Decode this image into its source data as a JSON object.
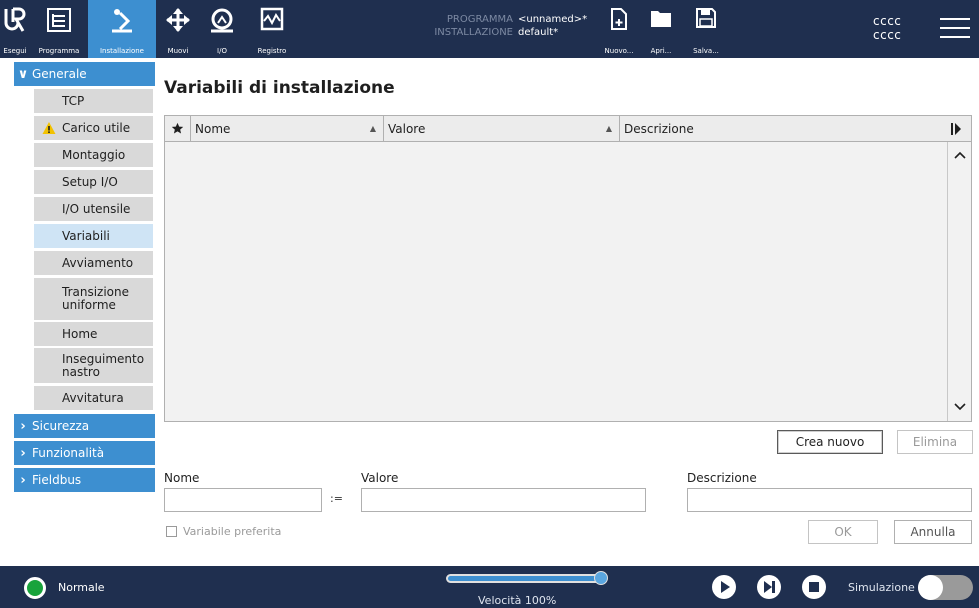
{
  "header": {
    "nav": [
      {
        "label": "Esegui",
        "icon": "ur-logo-icon"
      },
      {
        "label": "Programma",
        "icon": "program-tree-icon"
      },
      {
        "label": "Installazione",
        "icon": "installation-robot-icon",
        "active": true
      },
      {
        "label": "Muovi",
        "icon": "move-arrows-icon"
      },
      {
        "label": "I/O",
        "icon": "io-icon"
      },
      {
        "label": "Registro",
        "icon": "log-chart-icon"
      }
    ],
    "program_key": "PROGRAMMA",
    "program_value": "<unnamed>*",
    "installation_key": "INSTALLAZIONE",
    "installation_value": "default*",
    "file_actions": [
      {
        "label": "Nuovo...",
        "icon": "new-file-icon"
      },
      {
        "label": "Apri...",
        "icon": "open-folder-icon"
      },
      {
        "label": "Salva...",
        "icon": "save-disk-icon"
      }
    ],
    "user_line1": "cccc",
    "user_line2": "cccc"
  },
  "sidebar": {
    "groups": [
      {
        "label": "Generale",
        "expanded": true
      },
      {
        "label": "Sicurezza",
        "expanded": false
      },
      {
        "label": "Funzionalità",
        "expanded": false
      },
      {
        "label": "Fieldbus",
        "expanded": false
      }
    ],
    "items": [
      {
        "label": "TCP"
      },
      {
        "label": "Carico utile",
        "warning": true
      },
      {
        "label": "Montaggio"
      },
      {
        "label": "Setup I/O"
      },
      {
        "label": "I/O utensile"
      },
      {
        "label": "Variabili",
        "selected": true
      },
      {
        "label": "Avviamento"
      },
      {
        "label": "Transizione uniforme"
      },
      {
        "label": "Home"
      },
      {
        "label": "Inseguimento nastro"
      },
      {
        "label": "Avvitatura"
      }
    ]
  },
  "main": {
    "title": "Variabili di installazione",
    "table": {
      "columns": [
        "Nome",
        "Valore",
        "Descrizione"
      ],
      "star_icon": "star-icon",
      "rows": []
    },
    "buttons": {
      "create": "Crea nuovo",
      "delete": "Elimina",
      "ok": "OK",
      "cancel": "Annulla"
    },
    "form": {
      "name_label": "Nome",
      "value_label": "Valore",
      "description_label": "Descrizione",
      "assign_operator": ":=",
      "favorite_label": "Variabile preferita",
      "name_value": "",
      "value_value": "",
      "description_value": ""
    }
  },
  "footer": {
    "status": "Normale",
    "status_color": "#19a33c",
    "speed_label": "Velocità 100%",
    "speed_fraction": 1.0,
    "simulation_label": "Simulazione",
    "simulation_on": false
  },
  "colors": {
    "header_bg": "#1f2f4f",
    "accent": "#3d8fd0",
    "selected_item": "#cfe4f5",
    "item_bg": "#d9d9d9"
  }
}
